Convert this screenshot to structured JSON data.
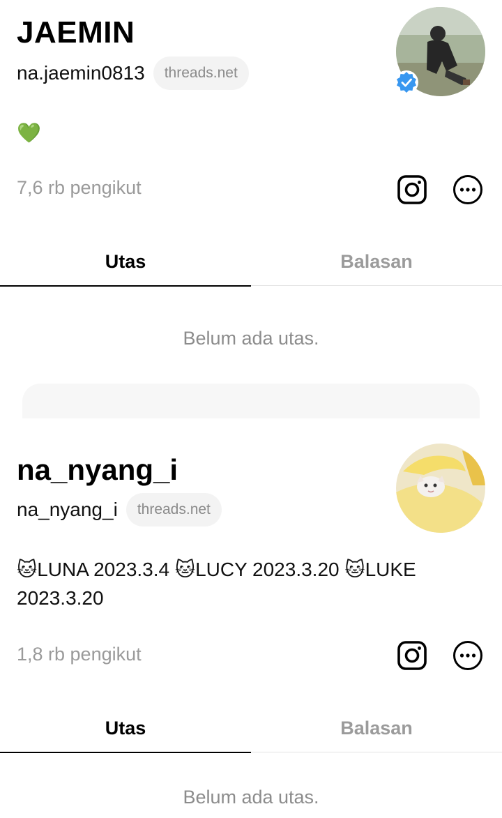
{
  "profiles": [
    {
      "display_name": "JAEMIN",
      "username": "na.jaemin0813",
      "domain_chip": "threads.net",
      "bio": "💚",
      "followers": "7,6 rb pengikut",
      "verified": true,
      "tabs": [
        {
          "label": "Utas",
          "active": true
        },
        {
          "label": "Balasan",
          "active": false
        }
      ],
      "empty_message": "Belum ada utas."
    },
    {
      "display_name": "na_nyang_i",
      "username": "na_nyang_i",
      "domain_chip": "threads.net",
      "bio": "🐱LUNA 2023.3.4 🐱LUCY 2023.3.20 🐱LUKE 2023.3.20",
      "followers": "1,8 rb pengikut",
      "verified": false,
      "tabs": [
        {
          "label": "Utas",
          "active": true
        },
        {
          "label": "Balasan",
          "active": false
        }
      ],
      "empty_message": "Belum ada utas."
    }
  ],
  "icons": {
    "instagram": "instagram-icon",
    "more": "more-options-icon",
    "verified": "verified-badge-icon"
  },
  "colors": {
    "verified_blue": "#3897f0",
    "muted_text": "#9a9a9a",
    "chip_bg": "#f3f3f3"
  }
}
